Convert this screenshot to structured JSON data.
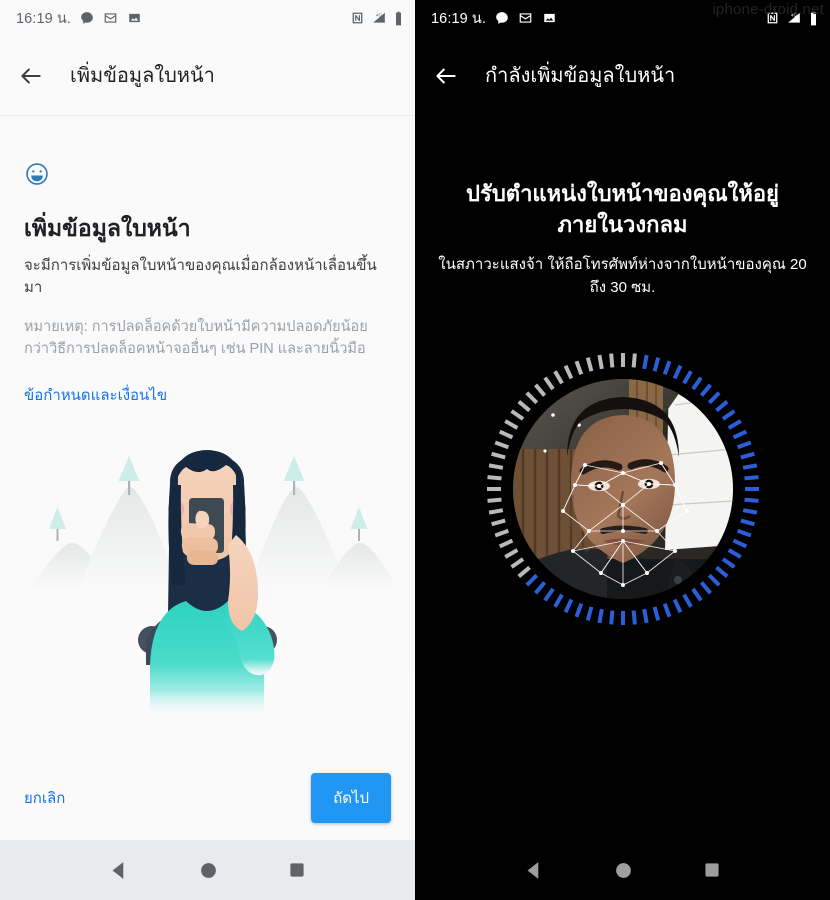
{
  "meta": {
    "watermark": "iphone-droid.net"
  },
  "left": {
    "status": {
      "time": "16:19 น.",
      "icons_left": [
        "message-icon",
        "gmail-icon",
        "photos-icon"
      ],
      "icons_right": [
        "nfc-icon",
        "signal-4g-icon",
        "battery-icon"
      ]
    },
    "appbar": {
      "back_icon": "back-arrow-icon",
      "title": "เพิ่มข้อมูลใบหน้า"
    },
    "body": {
      "face_icon": "smiley-face-icon",
      "headline": "เพิ่มข้อมูลใบหน้า",
      "subtitle": "จะมีการเพิ่มข้อมูลใบหน้าของคุณเมื่อกล้องหน้าเลื่อนขึ้นมา",
      "note": "หมายเหตุ: การปลดล็อคด้วยใบหน้ามีความปลอดภัยน้อยกว่าวิธีการปลดล็อคหน้าจออื่นๆ เช่น PIN และลายนิ้วมือ",
      "terms_link": "ข้อกำหนดและเงื่อนไข"
    },
    "illustration": {
      "name": "person-holding-phone-illustration",
      "shirt_color": "#2ed0bd",
      "hair_color": "#16283f",
      "skin_color": "#f3ccb2",
      "mountain_color": "#eceeed",
      "tree_color": "#cdeee8"
    },
    "actions": {
      "cancel_label": "ยกเลิก",
      "next_label": "ถัดไป",
      "next_color": "#2196f3",
      "link_color": "#1a73e8"
    },
    "nav": [
      "back-nav-icon",
      "home-nav-icon",
      "recents-nav-icon"
    ]
  },
  "right": {
    "status": {
      "time": "16:19 น.",
      "icons_left": [
        "message-icon",
        "gmail-icon",
        "photos-icon"
      ],
      "icons_right": [
        "nfc-icon",
        "signal-4g-icon",
        "battery-icon"
      ]
    },
    "appbar": {
      "back_icon": "back-arrow-icon",
      "title": "กำลังเพิ่มข้อมูลใบหน้า"
    },
    "body": {
      "headline": "ปรับตำแหน่งใบหน้าของคุณให้อยู่ภายในวงกลม",
      "subtitle": "ในสภาวะแสงจ้า ให้ถือโทรศัพท์ห่างจากใบหน้าของคุณ 20 ถึง 30 ซม."
    },
    "scanner": {
      "name": "face-enrollment-scanner",
      "tick_total": 72,
      "ticks_completed": 44,
      "tick_color_done": "#2b5fd9",
      "tick_color_pending": "#b9b9b9",
      "mesh_color": "#ffffff",
      "preview": "front-camera-face-preview"
    },
    "nav": [
      "back-nav-icon",
      "home-nav-icon",
      "recents-nav-icon"
    ]
  }
}
